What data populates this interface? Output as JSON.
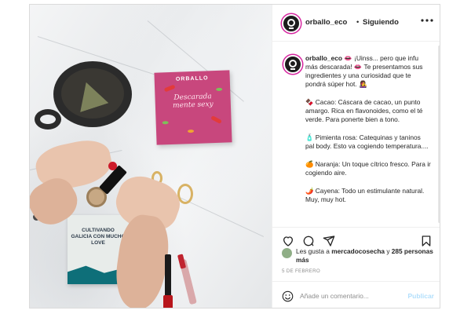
{
  "post": {
    "username": "orballo_eco",
    "separator": "•",
    "follow_status": "Siguiendo",
    "more_options_icon": "more-horizontal-icon"
  },
  "photo": {
    "box_brand": "ORBALLO",
    "box_script": "Descarada mente sexy",
    "book_title": "CULTIVANDO GALICIA CON MUCHO LOVE"
  },
  "caption": {
    "username": "orballo_eco",
    "intro": "👄 ¡Uinss... pero que infu más descarada! 👄 Te presentamos sus ingredientes y una curiosidad que te pondrá súper hot. 👩‍🎤",
    "items": [
      "🍫 Cacao: Cáscara de cacao, un punto amargo. Rica en flavonoides, como el té verde. Para ponerte bien a tono.",
      "🧴 Pimienta rosa: Catequinas y taninos pal body. Esto va cogiendo temperatura....",
      "🍊 Naranja: Un toque cítrico fresco. Para ir cogiendo aire.",
      "🌶️ Cayena: Todo un estimulante natural. Muy, muy hot."
    ]
  },
  "actions": {
    "like_icon": "heart-icon",
    "comment_icon": "comment-icon",
    "share_icon": "share-icon",
    "save_icon": "bookmark-icon"
  },
  "likes": {
    "prefix": "Les gusta a ",
    "user": "mercadocosecha",
    "middle": " y ",
    "others": "285 personas más"
  },
  "date": "5 DE FEBRERO",
  "comment": {
    "placeholder": "Añade un comentario...",
    "publish_label": "Publicar",
    "emoji_icon": "smile-icon"
  },
  "colors": {
    "story_ring": "#d6249f",
    "publish_disabled": "#b2dffc",
    "box_pink": "#c8477d"
  }
}
